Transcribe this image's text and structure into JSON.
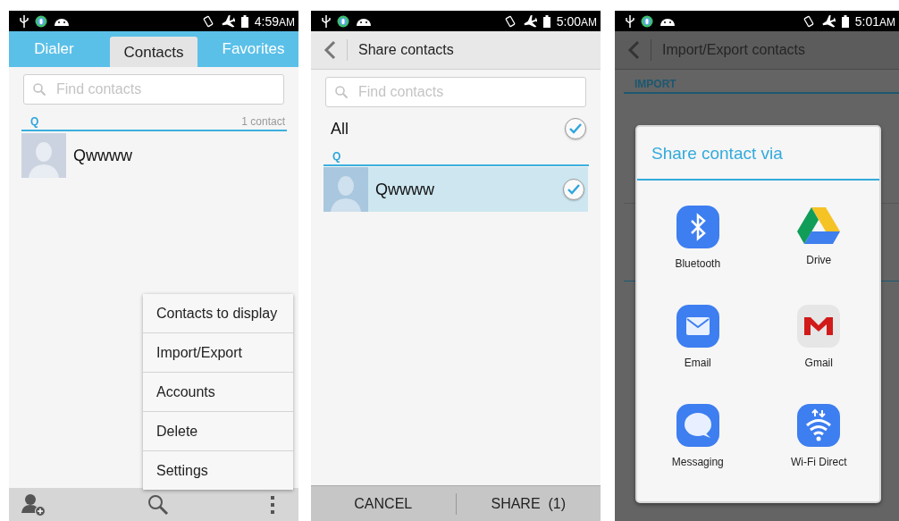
{
  "screens": [
    {
      "kind": "contacts",
      "status_bar": {
        "time": "4:59",
        "ampm": "AM"
      },
      "tabs": [
        {
          "label": "Dialer",
          "selected": false
        },
        {
          "label": "Contacts",
          "selected": true
        },
        {
          "label": "Favorites",
          "selected": false
        }
      ],
      "search": {
        "placeholder": "Find contacts"
      },
      "section": {
        "letter": "Q",
        "count": "1 contact"
      },
      "contacts": [
        {
          "name": "Qwwww"
        }
      ],
      "menu": [
        "Contacts to display",
        "Import/Export",
        "Accounts",
        "Delete",
        "Settings"
      ]
    },
    {
      "kind": "share",
      "status_bar": {
        "time": "5:00",
        "ampm": "AM"
      },
      "title": "Share contacts",
      "search": {
        "placeholder": "Find contacts"
      },
      "all": {
        "label": "All",
        "checked": true
      },
      "section": {
        "letter": "Q"
      },
      "contacts": [
        {
          "name": "Qwwww",
          "selected": true,
          "checked": true
        }
      ],
      "buttons": [
        "CANCEL",
        "SHARE  (1)"
      ]
    },
    {
      "kind": "import",
      "status_bar": {
        "time": "5:01",
        "ampm": "AM"
      },
      "title": "Import/Export contacts",
      "section_label": "IMPORT",
      "dialog": {
        "title": "Share contact via",
        "apps": [
          {
            "kind": "bluetooth",
            "label": "Bluetooth"
          },
          {
            "kind": "drive",
            "label": "Drive"
          },
          {
            "kind": "email",
            "label": "Email"
          },
          {
            "kind": "gmail",
            "label": "Gmail"
          },
          {
            "kind": "messaging",
            "label": "Messaging"
          },
          {
            "kind": "wifi",
            "label": "Wi-Fi Direct"
          }
        ]
      }
    }
  ]
}
